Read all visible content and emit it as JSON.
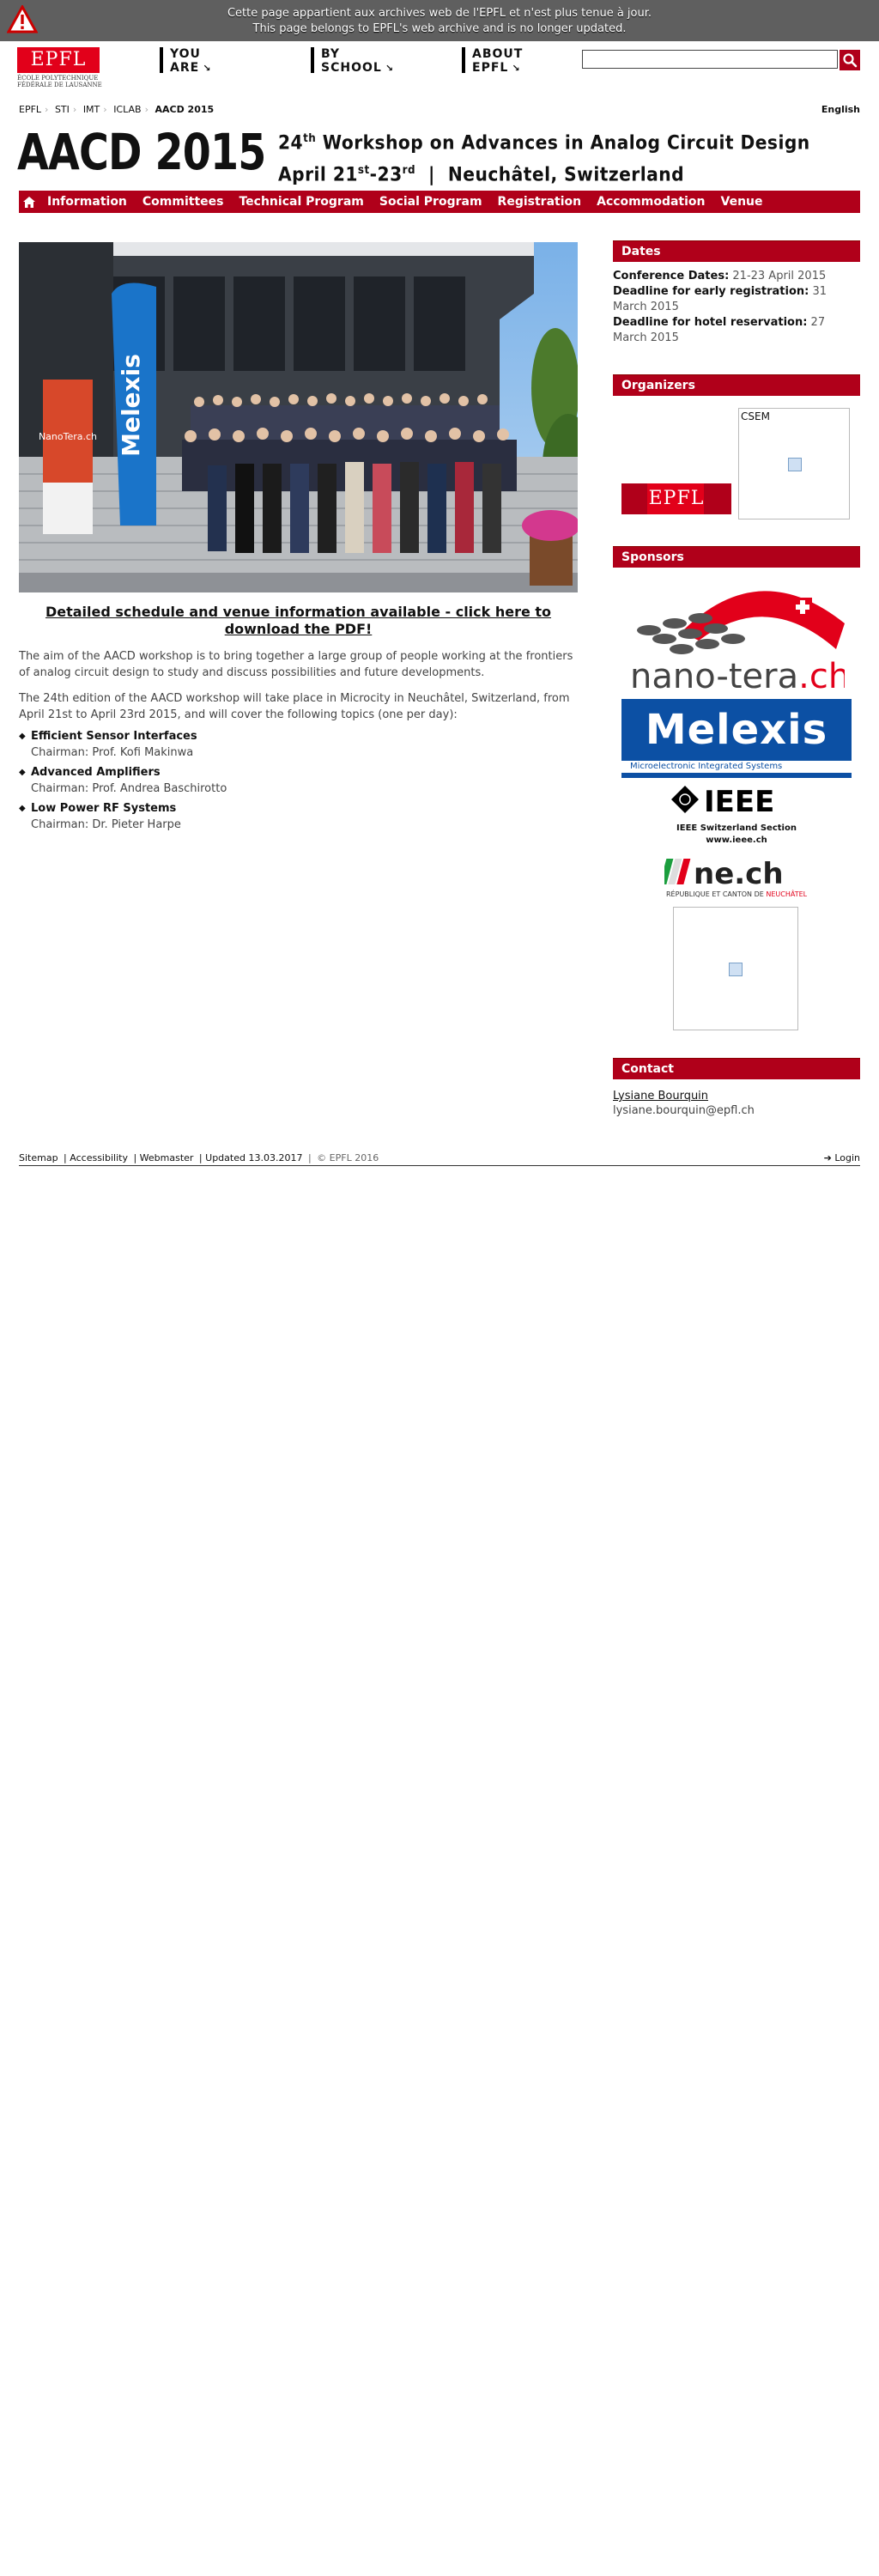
{
  "archive_banner": {
    "line1": "Cette page appartient aux archives web de l'EPFL et n'est plus tenue à jour.",
    "line2": "This page belongs to EPFL's web archive and is no longer updated."
  },
  "header": {
    "logo_text": "EPFL",
    "logo_subtitle_1": "ÉCOLE POLYTECHNIQUE",
    "logo_subtitle_2": "FÉDÉRALE DE LAUSANNE",
    "nav": [
      {
        "line1": "YOU",
        "line2": "ARE"
      },
      {
        "line1": "BY",
        "line2": "SCHOOL"
      },
      {
        "line1": "ABOUT",
        "line2": "EPFL"
      }
    ],
    "search": {
      "value": "",
      "placeholder": ""
    }
  },
  "breadcrumb": [
    "EPFL",
    "STI",
    "IMT",
    "ICLAB",
    "AACD 2015"
  ],
  "language": "English",
  "title": {
    "main": "AACD 2015",
    "line1_num": "24",
    "line1_sup": "th",
    "line1_text": " Workshop on Advances in Analog Circuit Design",
    "line2_a": "April 21",
    "line2_a_sup": "st",
    "line2_b": "-23",
    "line2_b_sup": "rd",
    "line2_c": "  |  Neuchâtel, Switzerland"
  },
  "menu": [
    "Information",
    "Committees",
    "Technical Program",
    "Social Program",
    "Registration",
    "Accommodation",
    "Venue"
  ],
  "photo_banner": {
    "text": "Melexis",
    "sign": "NanoTera.ch"
  },
  "pdf_link": "Detailed schedule and venue information available - click here to download the PDF!",
  "paragraphs": [
    "The aim of the AACD workshop is to bring together a large group of people working at the frontiers of analog circuit design to study and discuss possibilities and future developments.",
    "The 24th edition of the AACD workshop will take place in Microcity in Neuchâtel, Switzerland, from April 21st to April 23rd 2015, and will cover the following topics (one per day):"
  ],
  "topics": [
    {
      "title": "Efficient Sensor Interfaces",
      "chair": "Chairman: Prof. Kofi Makinwa"
    },
    {
      "title": "Advanced Amplifiers",
      "chair": "Chairman: Prof. Andrea Baschirotto"
    },
    {
      "title": "Low Power RF Systems",
      "chair": "Chairman: Dr. Pieter Harpe"
    }
  ],
  "sidebar": {
    "dates": {
      "heading": "Dates",
      "items": [
        {
          "label": "Conference Dates:",
          "value": " 21-23 April 2015"
        },
        {
          "label": "Deadline for early registration:",
          "value": " 31 March 2015"
        },
        {
          "label": "Deadline for hotel reservation:",
          "value": " 27 March 2015"
        }
      ]
    },
    "organizers": {
      "heading": "Organizers",
      "epfl_logo": "EPFL",
      "csem_label": "CSEM"
    },
    "sponsors": {
      "heading": "Sponsors",
      "nano_tera": "nano-tera",
      "nano_tera_suffix": ".ch",
      "melexis": "Melexis",
      "melexis_tagline": "Microelectronic Integrated Systems",
      "ieee": "IEEE",
      "ieee_section": "IEEE Switzerland Section",
      "ieee_url": "www.ieee.ch",
      "ne_ch": "ne.ch",
      "ne_ch_sub1": "RÉPUBLIQUE ET CANTON DE ",
      "ne_ch_sub2": "NEUCHÂTEL"
    },
    "contact": {
      "heading": "Contact",
      "name": "Lysiane Bourquin",
      "email": "lysiane.bourquin@epfl.ch"
    }
  },
  "footer": {
    "links": [
      "Sitemap",
      "Accessibility",
      "Webmaster"
    ],
    "updated": "Updated 13.03.2017",
    "copyright": "© EPFL 2016",
    "login": "Login"
  },
  "colors": {
    "brand_red": "#e2001a",
    "menu_red": "#b0001a",
    "banner_gray": "#5f5f5f"
  }
}
